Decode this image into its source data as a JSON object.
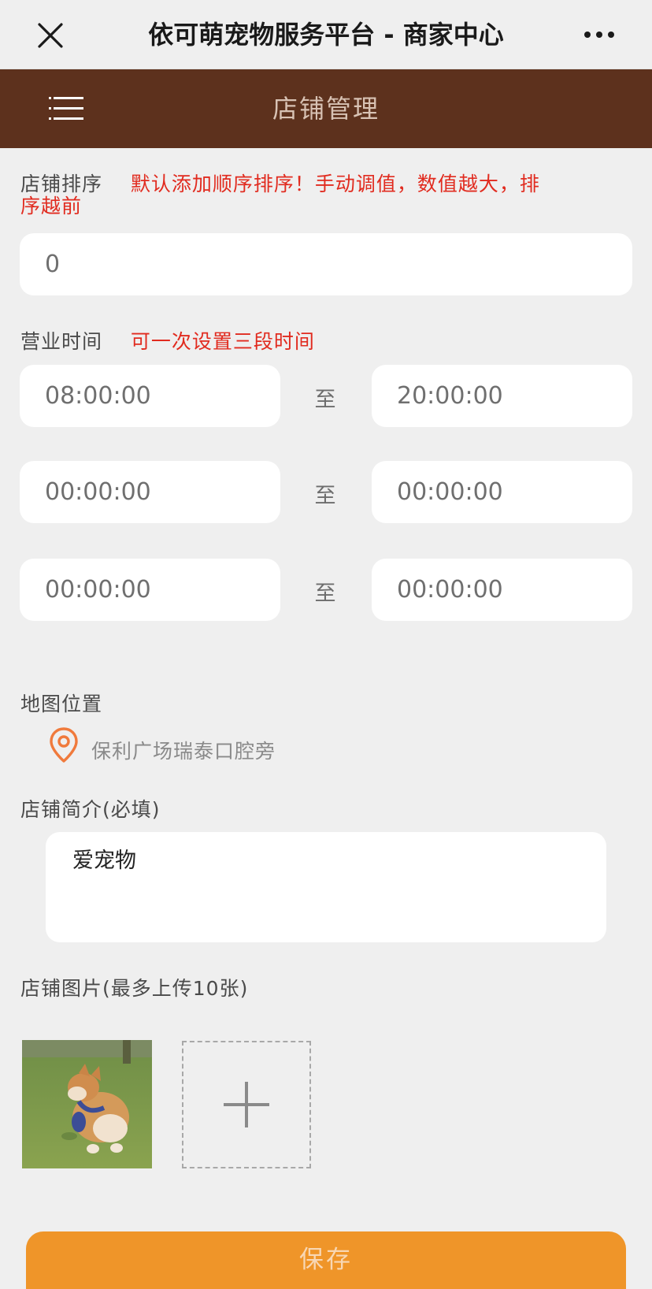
{
  "topbar": {
    "title": "依可萌宠物服务平台 - 商家中心"
  },
  "header": {
    "title": "店铺管理"
  },
  "sort": {
    "label": "店铺排序",
    "hint_line1": "默认添加顺序排序！手动调值，数值越大，排",
    "hint_line2": "序越前",
    "value": "0"
  },
  "hours": {
    "label": "营业时间",
    "hint": "可一次设置三段时间",
    "separator": "至",
    "slots": [
      {
        "start": "08:00:00",
        "end": "20:00:00"
      },
      {
        "start": "00:00:00",
        "end": "00:00:00"
      },
      {
        "start": "00:00:00",
        "end": "00:00:00"
      }
    ]
  },
  "map": {
    "label": "地图位置",
    "address": "保利广场瑞泰口腔旁",
    "icon": "location-pin-icon",
    "icon_color": "#f07a3c"
  },
  "intro": {
    "label": "店铺简介(必填)",
    "value": "爱宠物"
  },
  "images": {
    "label": "店铺图片(最多上传10张)",
    "photo": "corgi-dog-photo",
    "add_icon": "plus-icon"
  },
  "save": {
    "label": "保存",
    "color": "#ef9529"
  },
  "colors": {
    "header": "#5d311d",
    "hint": "#e12b1f"
  }
}
